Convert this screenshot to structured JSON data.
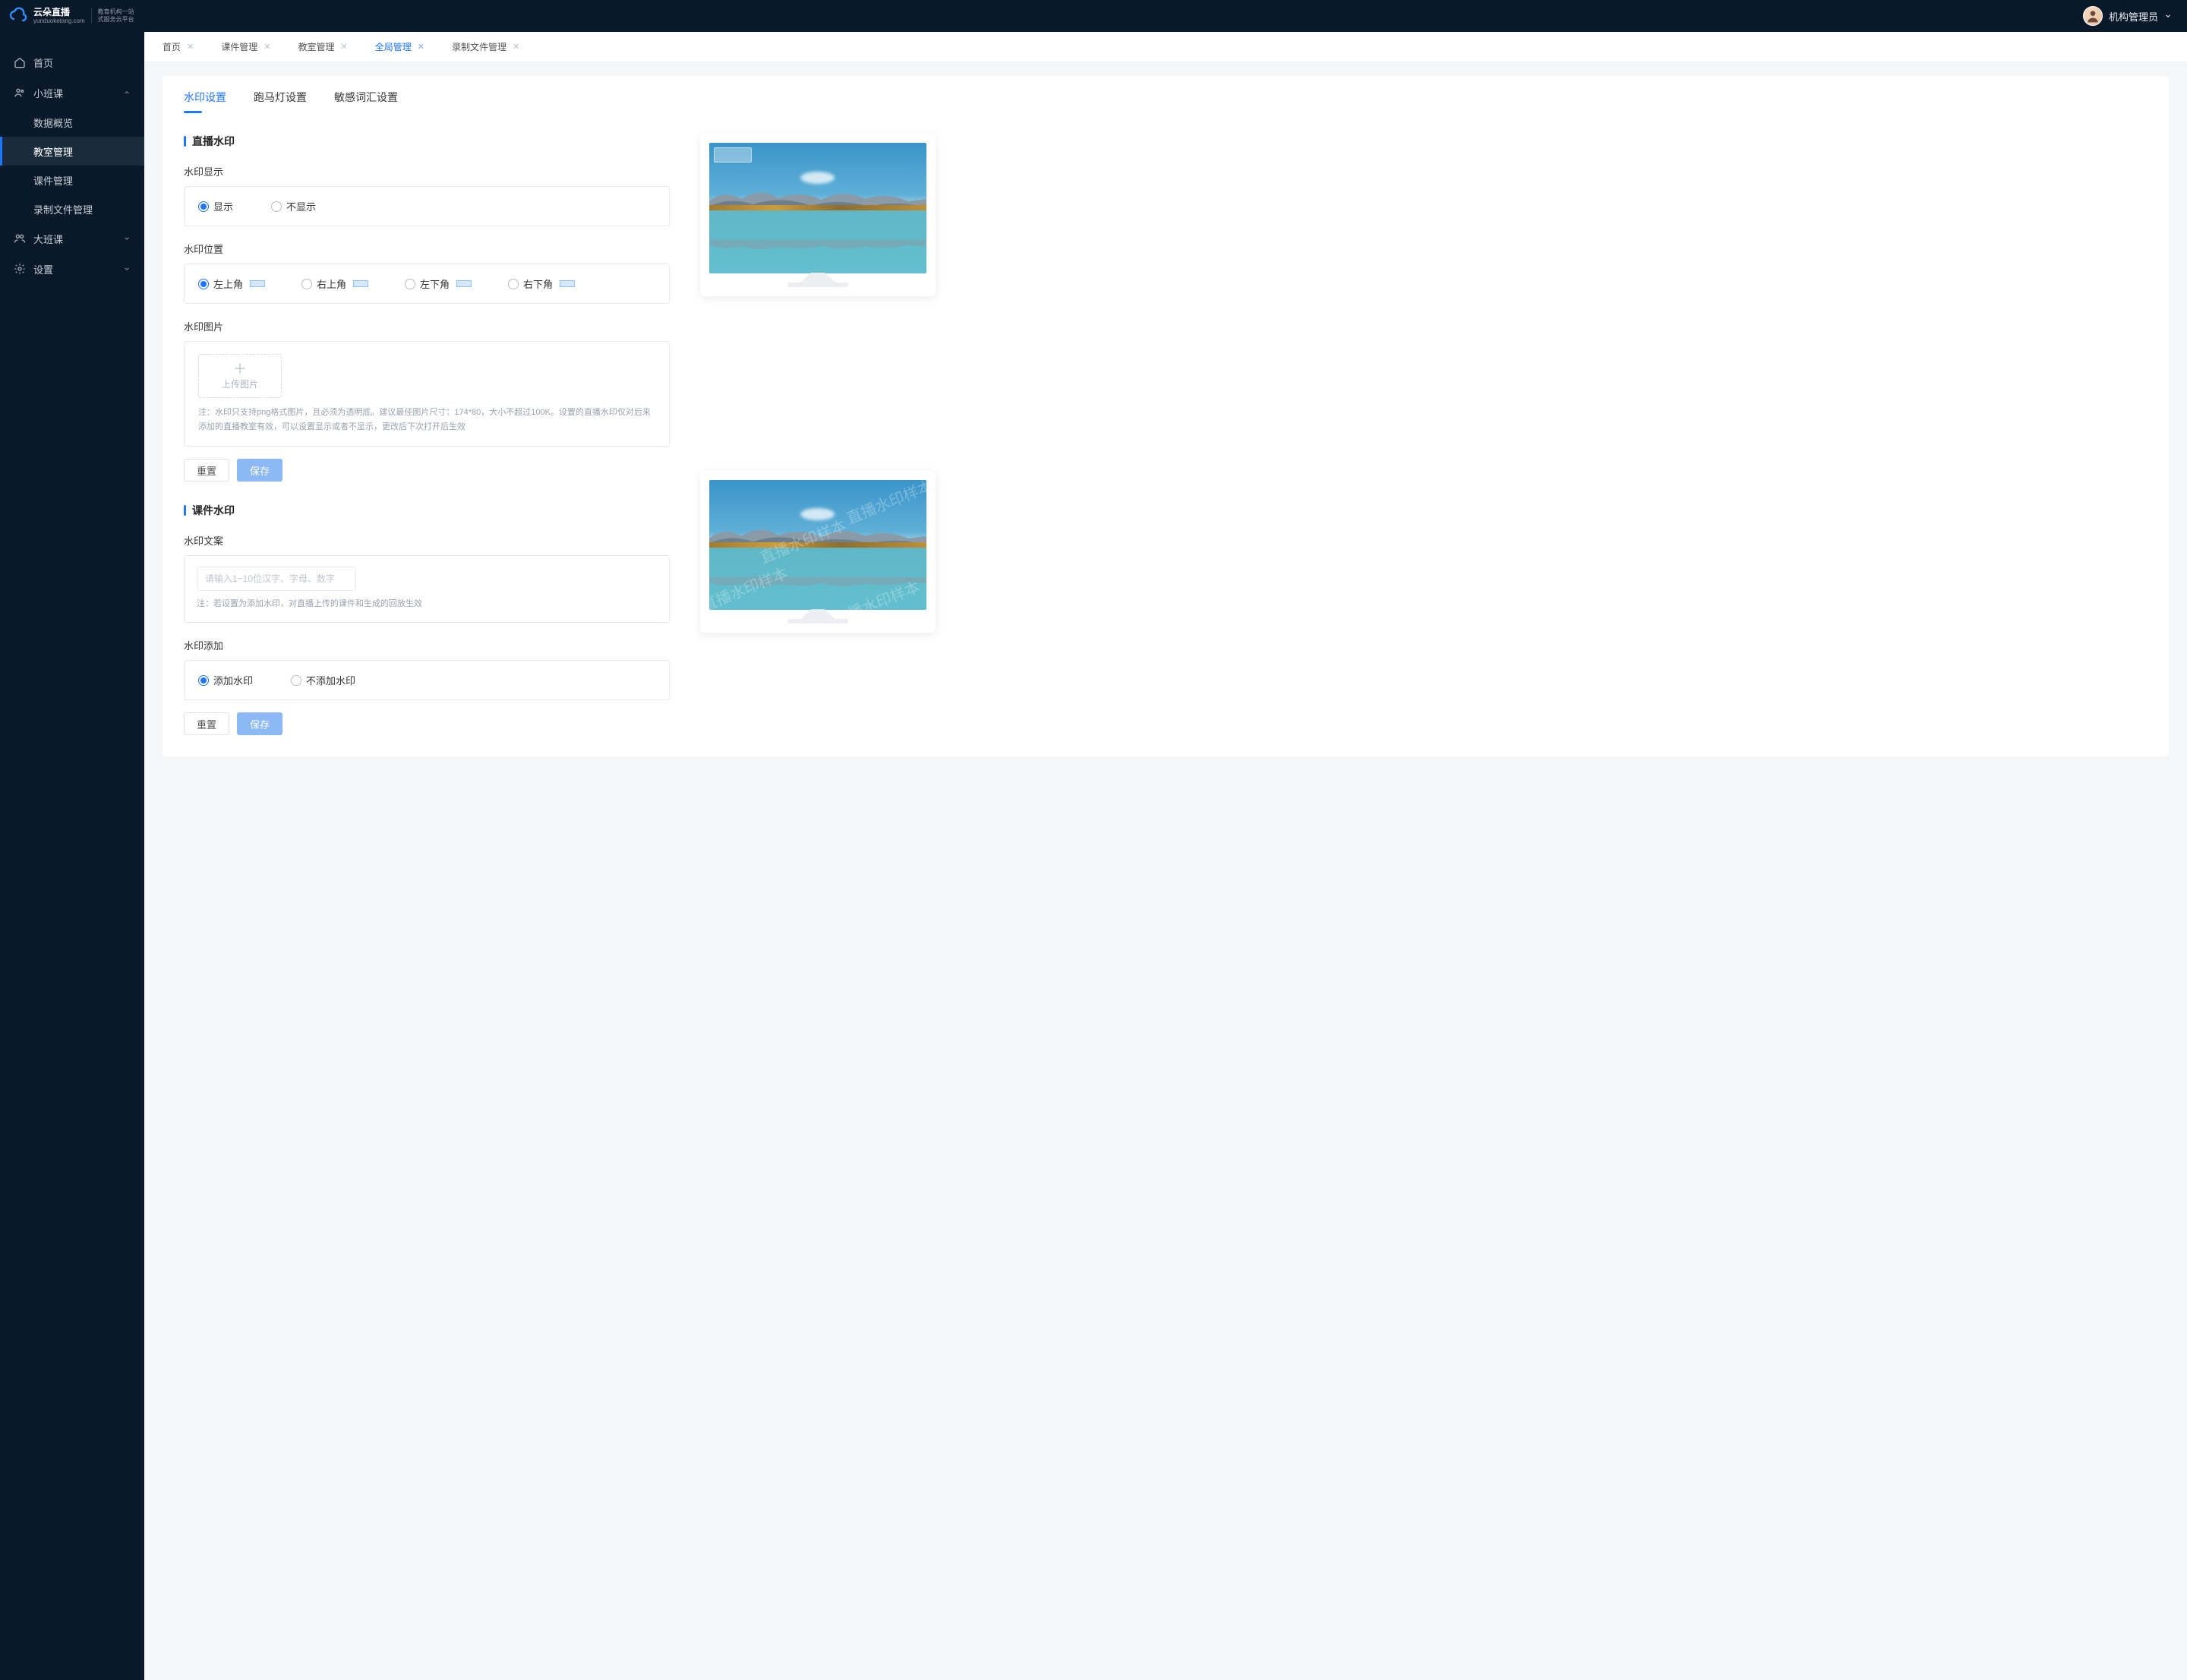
{
  "brand": {
    "name": "云朵直播",
    "domain": "yunduoketang.com",
    "slogan_line1": "教育机构一站",
    "slogan_line2": "式服务云平台"
  },
  "user": {
    "name": "机构管理员"
  },
  "sidebar": {
    "items": [
      {
        "label": "首页"
      },
      {
        "label": "小班课",
        "expanded": true,
        "children": [
          {
            "label": "数据概览"
          },
          {
            "label": "教室管理",
            "active": true
          },
          {
            "label": "课件管理"
          },
          {
            "label": "录制文件管理"
          }
        ]
      },
      {
        "label": "大班课",
        "expanded": false
      },
      {
        "label": "设置",
        "expanded": false
      }
    ]
  },
  "tabs": [
    {
      "label": "首页",
      "active": false
    },
    {
      "label": "课件管理",
      "active": false
    },
    {
      "label": "教室管理",
      "active": false
    },
    {
      "label": "全局管理",
      "active": true
    },
    {
      "label": "录制文件管理",
      "active": false
    }
  ],
  "section_tabs": [
    {
      "label": "水印设置",
      "active": true
    },
    {
      "label": "跑马灯设置",
      "active": false
    },
    {
      "label": "敏感词汇设置",
      "active": false
    }
  ],
  "live_watermark": {
    "title": "直播水印",
    "display_label": "水印显示",
    "display_options": {
      "show": "显示",
      "hide": "不显示"
    },
    "display_value": "show",
    "position_label": "水印位置",
    "position_options": {
      "tl": "左上角",
      "tr": "右上角",
      "bl": "左下角",
      "br": "右下角"
    },
    "position_value": "tl",
    "image_label": "水印图片",
    "upload_label": "上传图片",
    "note": "注：水印只支持png格式图片，且必须为透明底。建议最佳图片尺寸：174*80，大小不超过100K。设置的直播水印仅对后来添加的直播教室有效，可以设置显示或者不显示，更改后下次打开后生效",
    "reset": "重置",
    "save": "保存"
  },
  "courseware_watermark": {
    "title": "课件水印",
    "text_label": "水印文案",
    "text_placeholder": "请输入1~10位汉字、字母、数字",
    "note": "注：若设置为添加水印，对直播上传的课件和生成的回放生效",
    "add_label": "水印添加",
    "add_options": {
      "yes": "添加水印",
      "no": "不添加水印"
    },
    "add_value": "yes",
    "reset": "重置",
    "save": "保存",
    "preview_text": "直播水印样本"
  }
}
